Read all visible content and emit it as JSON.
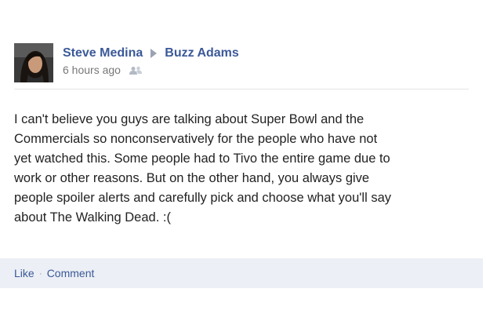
{
  "post": {
    "author": "Steve Medina",
    "target": "Buzz Adams",
    "timestamp": "6 hours ago",
    "audience_icon": "friends-icon",
    "message": "I can't believe you guys are talking about Super Bowl and the\nCommercials so nonconservatively for the people who have not\nyet watched this. Some people had to Tivo the entire game due to\nwork or other reasons. But on the other hand, you always give\npeople spoiler alerts and carefully pick and choose what you'll say\nabout The Walking Dead. :("
  },
  "actions": {
    "like_label": "Like",
    "separator": "·",
    "comment_label": "Comment"
  },
  "colors": {
    "link": "#3b5998",
    "timestamp": "#777777",
    "action_bar_bg": "#eceff5",
    "text": "#222222"
  }
}
